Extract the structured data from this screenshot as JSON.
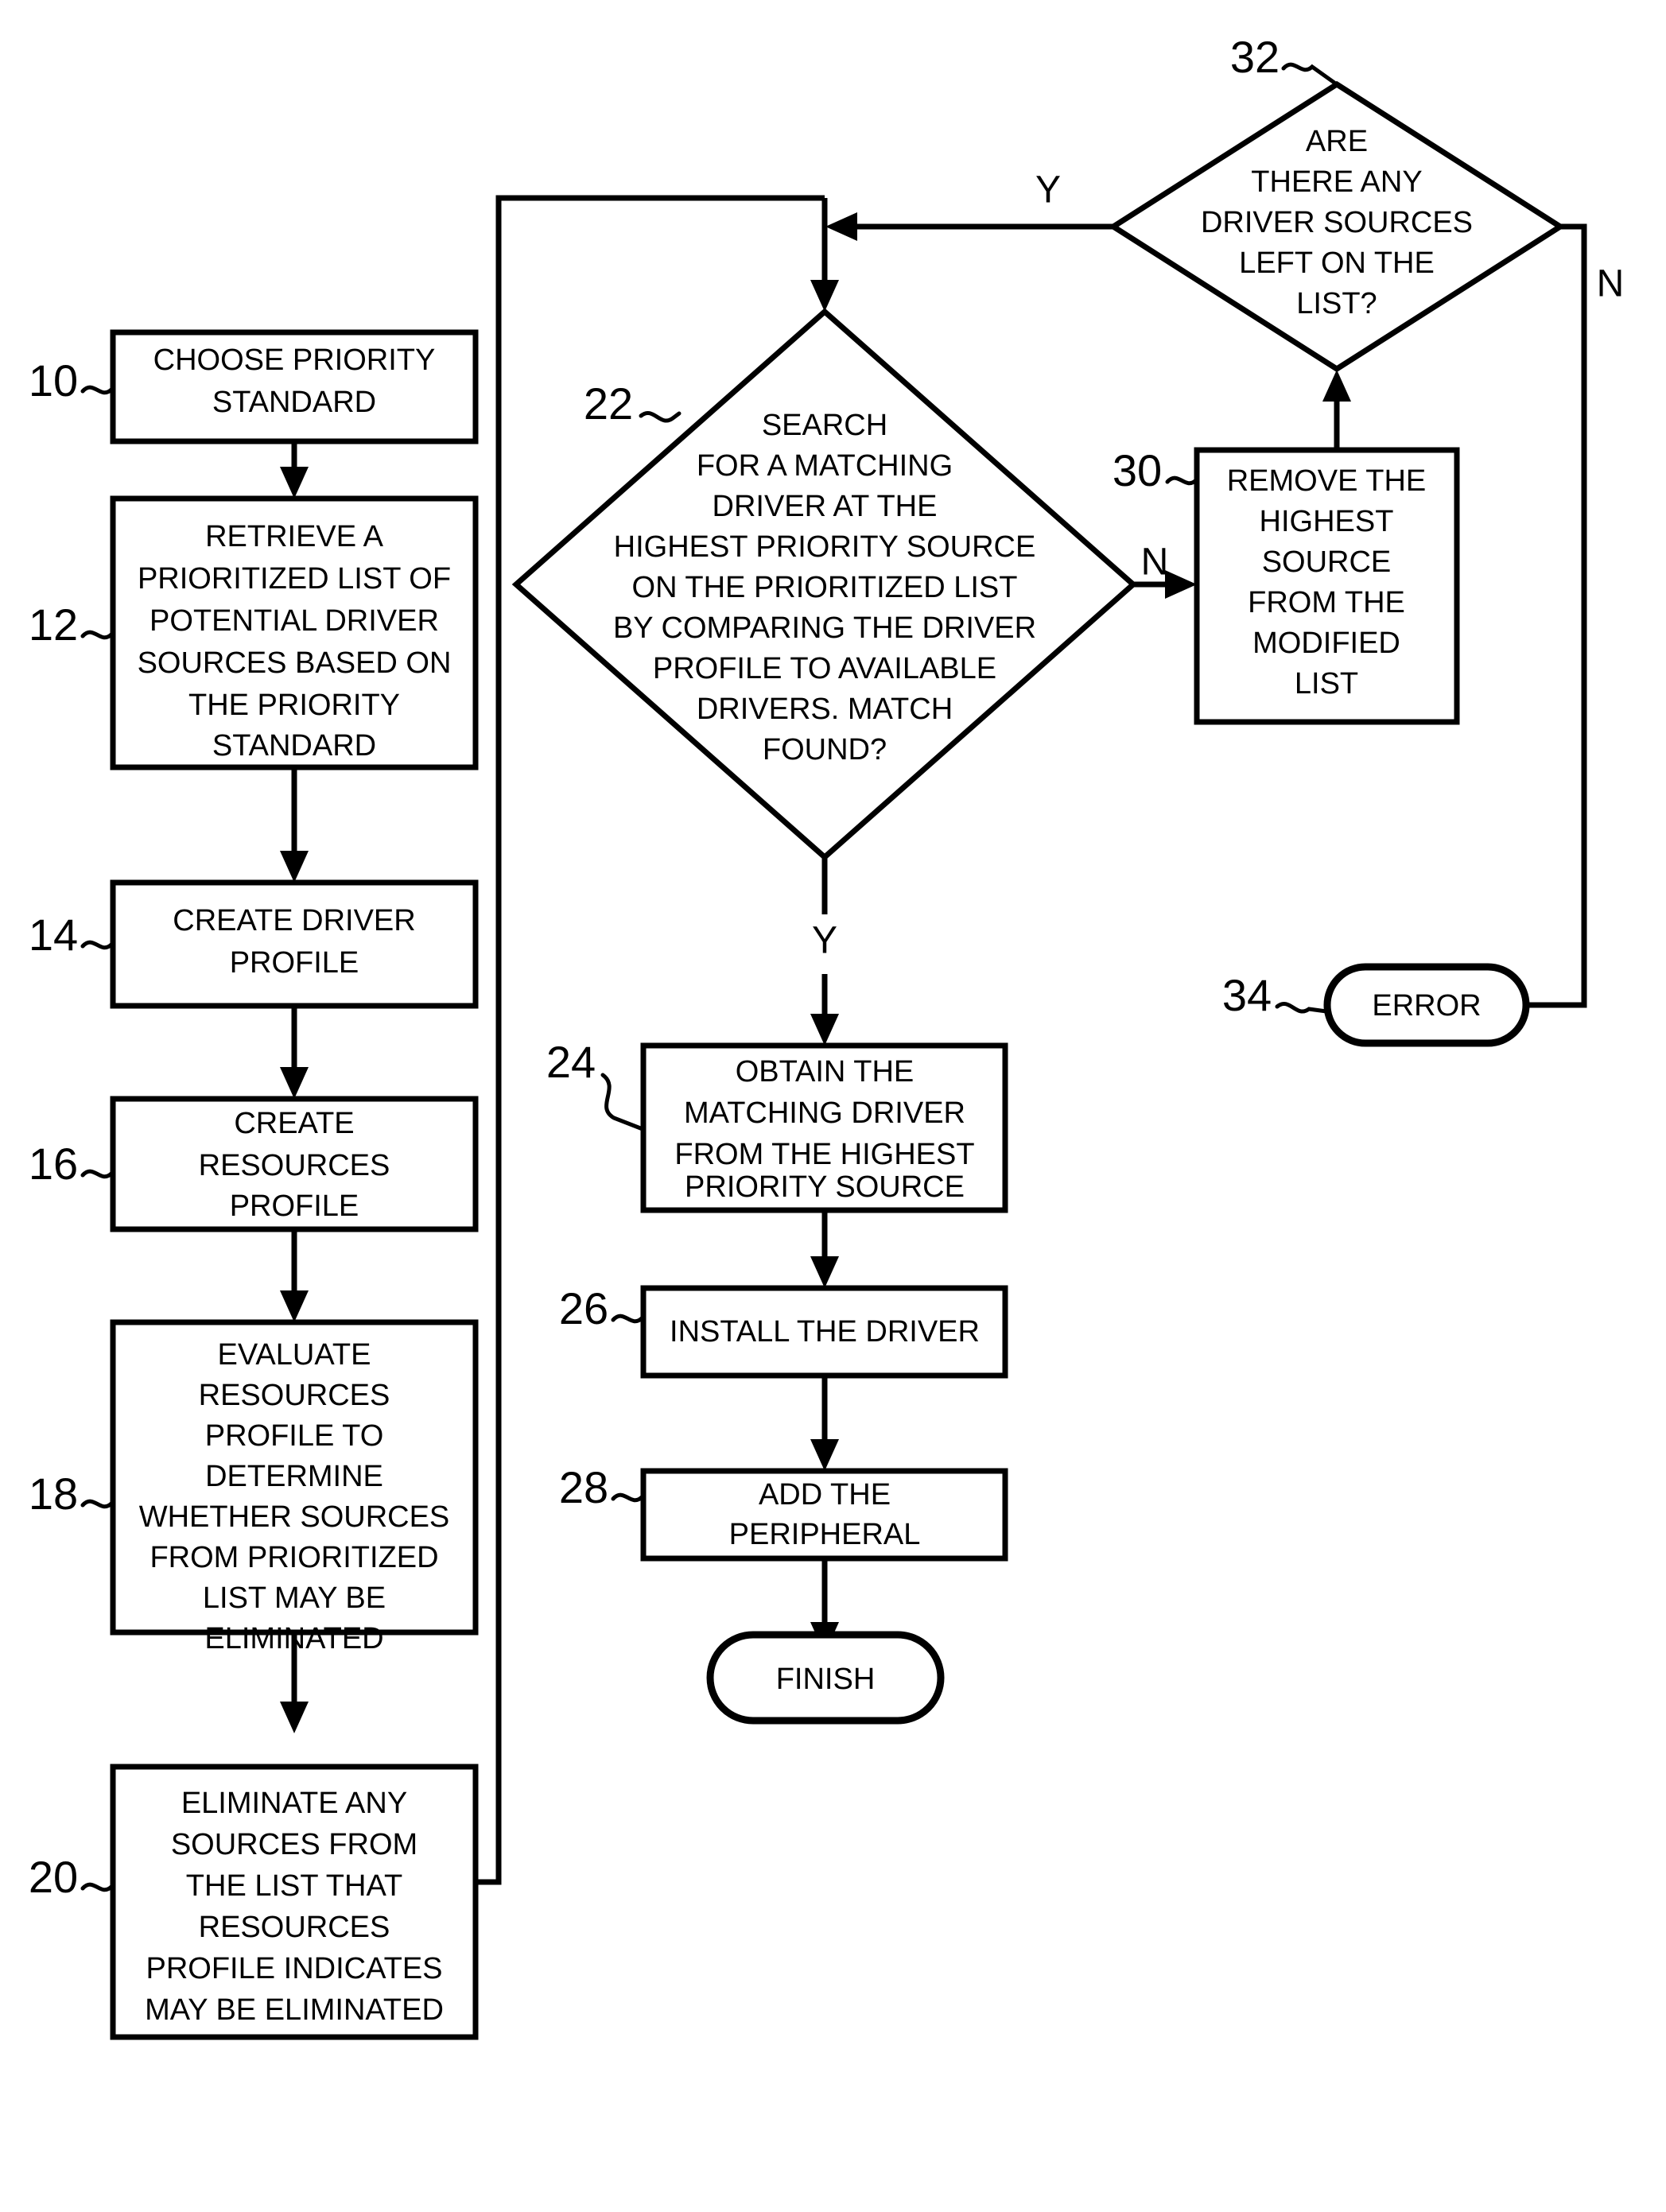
{
  "diagram": {
    "type": "flowchart",
    "title": "Driver source prioritization and installation flowchart",
    "background_color": "#ffffff",
    "line_color": "#000000"
  },
  "nodes": {
    "n10": {
      "ref": "10",
      "shape": "process",
      "lines": [
        "CHOOSE PRIORITY",
        "STANDARD"
      ]
    },
    "n12": {
      "ref": "12",
      "shape": "process",
      "lines": [
        "RETRIEVE A",
        "PRIORITIZED LIST OF",
        "POTENTIAL DRIVER",
        "SOURCES BASED ON",
        "THE PRIORITY",
        "STANDARD"
      ]
    },
    "n14": {
      "ref": "14",
      "shape": "process",
      "lines": [
        "CREATE DRIVER",
        "PROFILE"
      ]
    },
    "n16": {
      "ref": "16",
      "shape": "process",
      "lines": [
        "CREATE",
        "RESOURCES",
        "PROFILE"
      ]
    },
    "n18": {
      "ref": "18",
      "shape": "process",
      "lines": [
        "EVALUATE",
        "RESOURCES",
        "PROFILE TO",
        "DETERMINE",
        "WHETHER SOURCES",
        "FROM PRIORITIZED",
        "LIST MAY BE",
        "ELIMINATED"
      ]
    },
    "n20": {
      "ref": "20",
      "shape": "process",
      "lines": [
        "ELIMINATE ANY",
        "SOURCES FROM",
        "THE LIST THAT",
        "RESOURCES",
        "PROFILE INDICATES",
        "MAY BE ELIMINATED"
      ]
    },
    "n22": {
      "ref": "22",
      "shape": "decision",
      "lines": [
        "SEARCH",
        "FOR A MATCHING",
        "DRIVER AT THE",
        "HIGHEST PRIORITY SOURCE",
        "ON THE PRIORITIZED LIST",
        "BY COMPARING THE DRIVER",
        "PROFILE TO AVAILABLE",
        "DRIVERS. MATCH",
        "FOUND?"
      ]
    },
    "n24": {
      "ref": "24",
      "shape": "process",
      "lines": [
        "OBTAIN THE",
        "MATCHING DRIVER",
        "FROM THE HIGHEST",
        "PRIORITY SOURCE"
      ]
    },
    "n26": {
      "ref": "26",
      "shape": "process",
      "lines": [
        "INSTALL THE DRIVER"
      ]
    },
    "n28": {
      "ref": "28",
      "shape": "process",
      "lines": [
        "ADD THE",
        "PERIPHERAL"
      ]
    },
    "n30": {
      "ref": "30",
      "shape": "process",
      "lines": [
        "REMOVE THE",
        "HIGHEST",
        "SOURCE",
        "FROM THE",
        "MODIFIED",
        "LIST"
      ]
    },
    "n32": {
      "ref": "32",
      "shape": "decision",
      "lines": [
        "ARE",
        "THERE ANY",
        "DRIVER SOURCES",
        "LEFT ON THE",
        "LIST?"
      ]
    },
    "n34": {
      "ref": "34",
      "shape": "terminator",
      "lines": [
        "ERROR"
      ]
    },
    "n_finish": {
      "ref": "",
      "shape": "terminator",
      "lines": [
        "FINISH"
      ]
    }
  },
  "branch_labels": {
    "d22_no": "N",
    "d22_yes": "Y",
    "d32_yes": "Y",
    "d32_no": "N"
  }
}
